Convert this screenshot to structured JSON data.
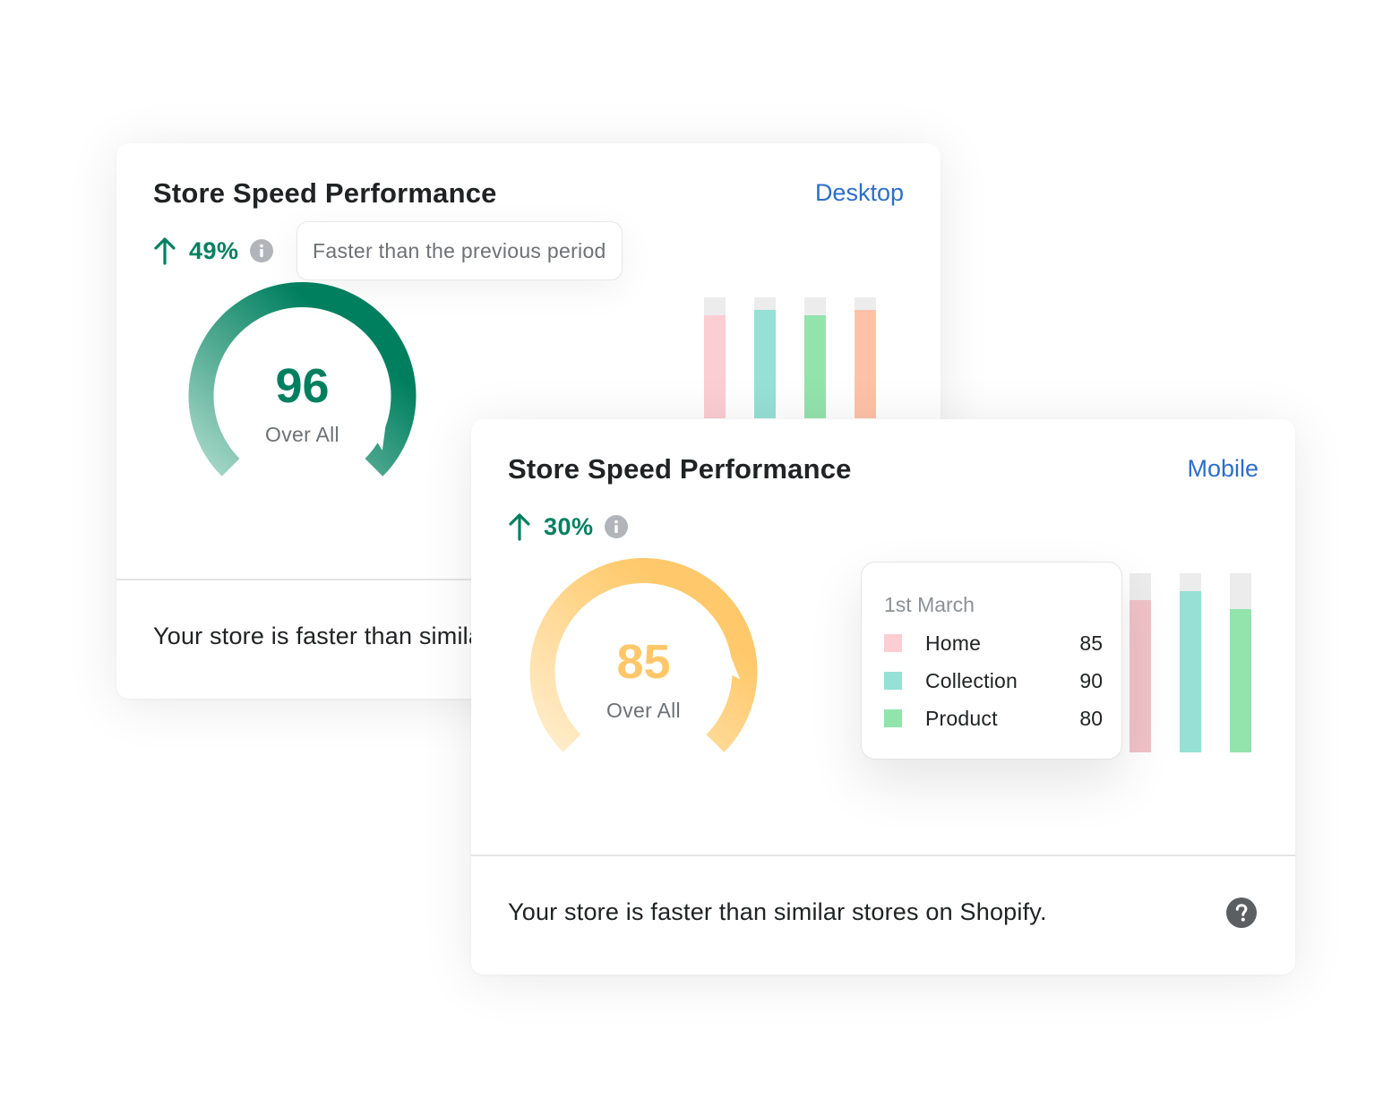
{
  "desktop_card": {
    "title": "Store Speed Performance",
    "view_label": "Desktop",
    "trend_pct": "49%",
    "tooltip": "Faster than the previous period",
    "score": "96",
    "score_label": "Over All",
    "score_value": 96,
    "gauge_colors": [
      "#a8d8c8",
      "#007f5f"
    ],
    "score_color": "#007f5f",
    "footer": "Your store is faster than similar stores on Shopify.",
    "chart_data": {
      "type": "bar",
      "categories": [
        "",
        "",
        "",
        ""
      ],
      "values": [
        85,
        90,
        85,
        90
      ],
      "colors": [
        "#fccdd3",
        "#96e0d5",
        "#93e3ad",
        "#ffc2a8"
      ],
      "ylim": [
        0,
        100
      ]
    }
  },
  "mobile_card": {
    "title": "Store Speed Performance",
    "view_label": "Mobile",
    "trend_pct": "30%",
    "score": "85",
    "score_label": "Over All",
    "score_value": 85,
    "gauge_colors": [
      "#ffedcc",
      "#ffc96b"
    ],
    "score_color": "#ffc76a",
    "footer": "Your store is faster than similar stores on Shopify.",
    "chart_data": {
      "type": "bar",
      "categories": [
        "Home",
        "Collection",
        "Product"
      ],
      "values": [
        85,
        90,
        80
      ],
      "colors": [
        "#f1c3c9",
        "#96e0d5",
        "#93e3ad"
      ],
      "ylim": [
        0,
        100
      ]
    },
    "legend": {
      "date": "1st March",
      "items": [
        {
          "name": "Home",
          "value": "85",
          "color": "#fccdd3"
        },
        {
          "name": "Collection",
          "value": "90",
          "color": "#96e0d5"
        },
        {
          "name": "Product",
          "value": "80",
          "color": "#93e3ad"
        }
      ]
    }
  },
  "colors": {
    "accent_green": "#008060",
    "link_blue": "#2c6ecb",
    "muted_text": "#6d7175"
  },
  "icons": [
    "arrow-up-icon",
    "info-icon",
    "help-icon"
  ]
}
